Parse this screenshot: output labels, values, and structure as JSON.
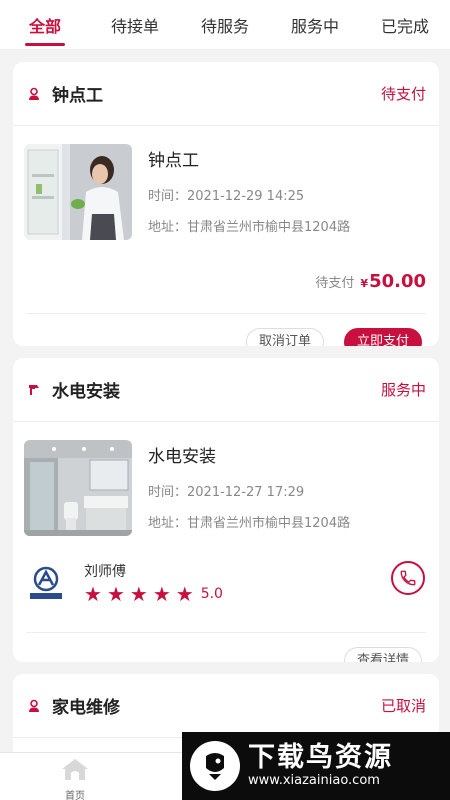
{
  "tabs": [
    {
      "label": "全部"
    },
    {
      "label": "待接单"
    },
    {
      "label": "待服务"
    },
    {
      "label": "服务中"
    },
    {
      "label": "已完成"
    }
  ],
  "active_tab": 0,
  "orders": [
    {
      "category": "钟点工",
      "status": "待支付",
      "service_name": "钟点工",
      "time": "时间：2021-12-29 14:25",
      "address": "地址：甘肃省兰州市榆中县1204路",
      "amount_label": "待支付",
      "currency": "¥",
      "amount": "50.00",
      "buttons": {
        "cancel": "取消订单",
        "pay": "立即支付"
      }
    },
    {
      "category": "水电安装",
      "status": "服务中",
      "service_name": "水电安装",
      "time": "时间：2021-12-27 17:29",
      "address": "地址：甘肃省兰州市榆中县1204路",
      "worker": {
        "name": "刘师傅",
        "rating": "5.0",
        "stars": 5
      },
      "buttons": {
        "details": "查看详情"
      }
    },
    {
      "category": "家电维修",
      "status": "已取消"
    }
  ],
  "bottom_nav": {
    "home": "首页"
  },
  "watermark": {
    "title": "下载鸟资源",
    "url": "www.xiazainiao.com"
  },
  "colors": {
    "accent": "#c8103e"
  }
}
